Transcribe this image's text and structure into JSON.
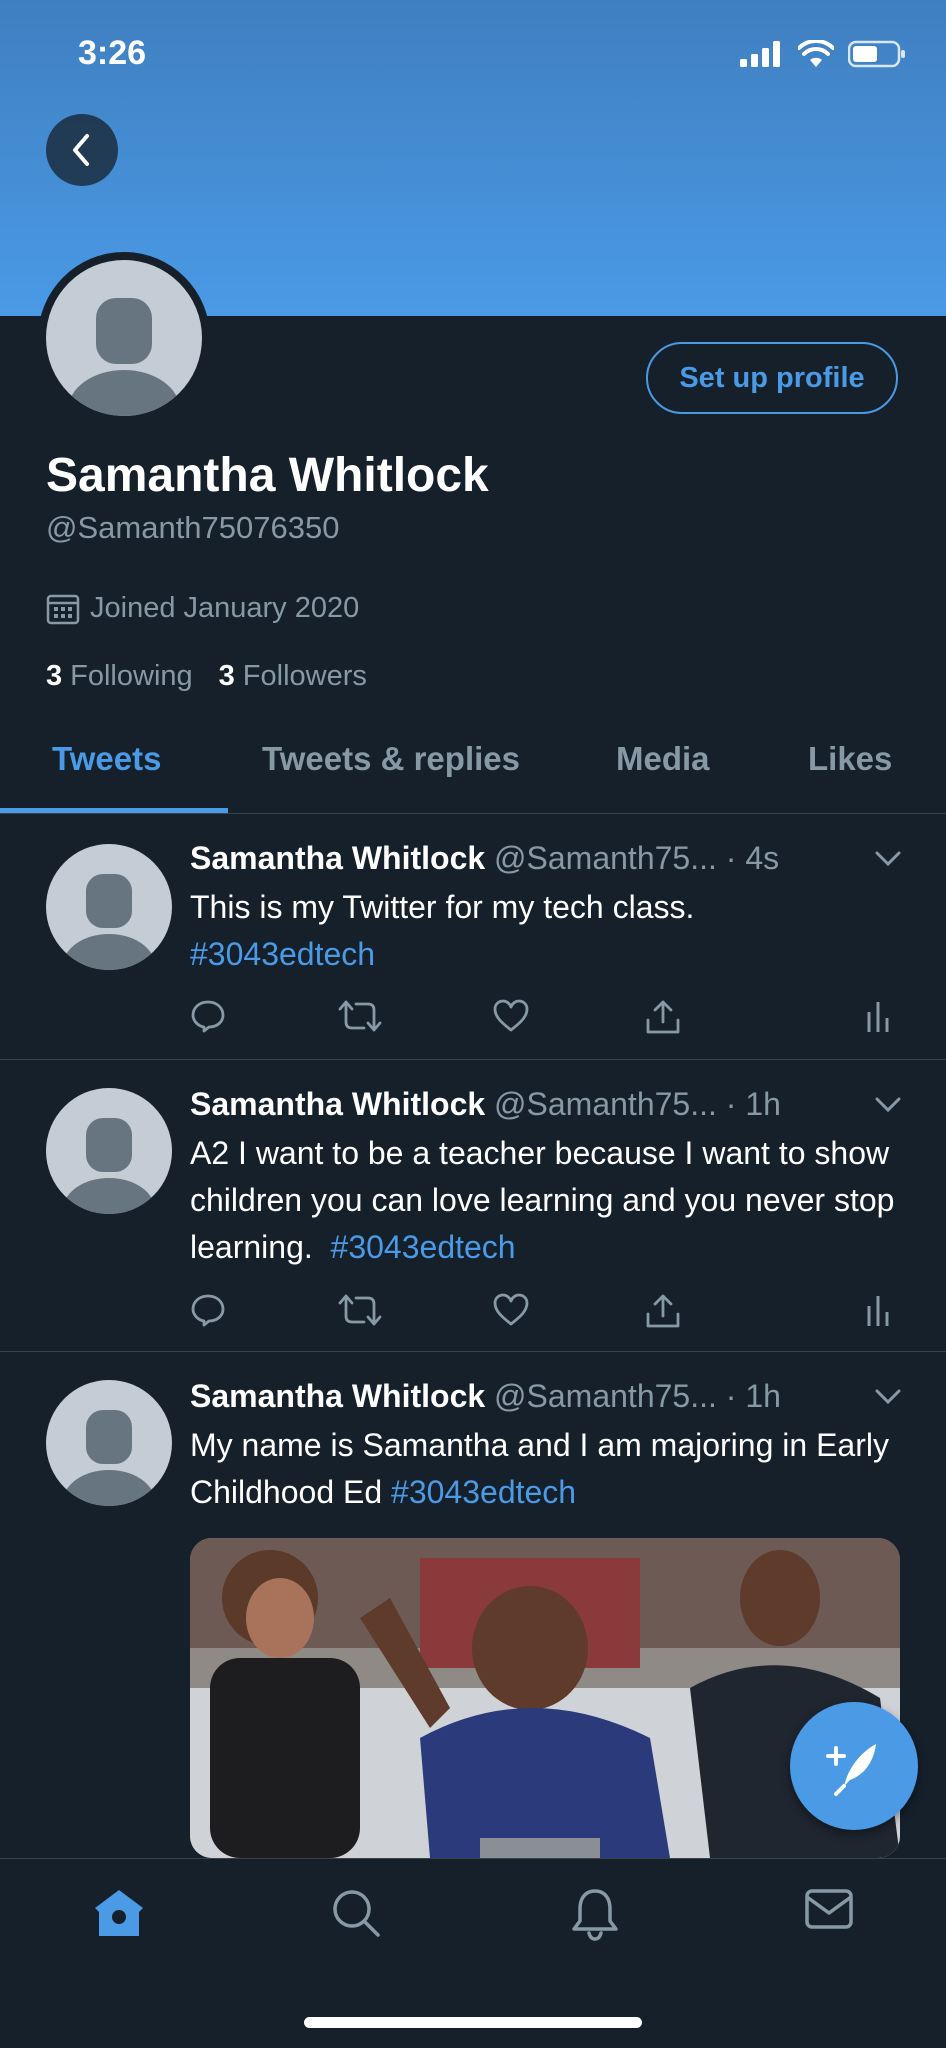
{
  "status_bar": {
    "time": "3:26",
    "icons": [
      "signal-icon",
      "wifi-icon",
      "battery-icon"
    ]
  },
  "header": {
    "back_icon": "chevron-left-icon",
    "setup_button": "Set up profile"
  },
  "profile": {
    "name": "Samantha Whitlock",
    "handle": "@Samanth75076350",
    "joined": "Joined January 2020",
    "following_count": "3",
    "following_label": "Following",
    "followers_count": "3",
    "followers_label": "Followers"
  },
  "tabs": [
    {
      "label": "Tweets",
      "active": true
    },
    {
      "label": "Tweets & replies",
      "active": false
    },
    {
      "label": "Media",
      "active": false
    },
    {
      "label": "Likes",
      "active": false
    }
  ],
  "tweets": [
    {
      "name": "Samantha Whitlock",
      "handle": "@Samanth75...",
      "time": "· 4s",
      "text": "This is my Twitter for my tech class.",
      "hashtag": "#3043edtech"
    },
    {
      "name": "Samantha Whitlock",
      "handle": "@Samanth75...",
      "time": "· 1h",
      "text": "A2 I want to be a teacher because I want to show children you can love learning and you never stop learning.",
      "hashtag": "#3043edtech"
    },
    {
      "name": "Samantha Whitlock",
      "handle": "@Samanth75...",
      "time": "· 1h",
      "text": "My name is Samantha and I am majoring in Early Childhood Ed",
      "hashtag": "#3043edtech"
    }
  ],
  "colors": {
    "accent": "#4a9ae6",
    "background": "#15202b",
    "muted": "#8899a6",
    "divider": "#38444d"
  },
  "bottom_nav": [
    "home-icon",
    "search-icon",
    "bell-icon",
    "mail-icon"
  ]
}
